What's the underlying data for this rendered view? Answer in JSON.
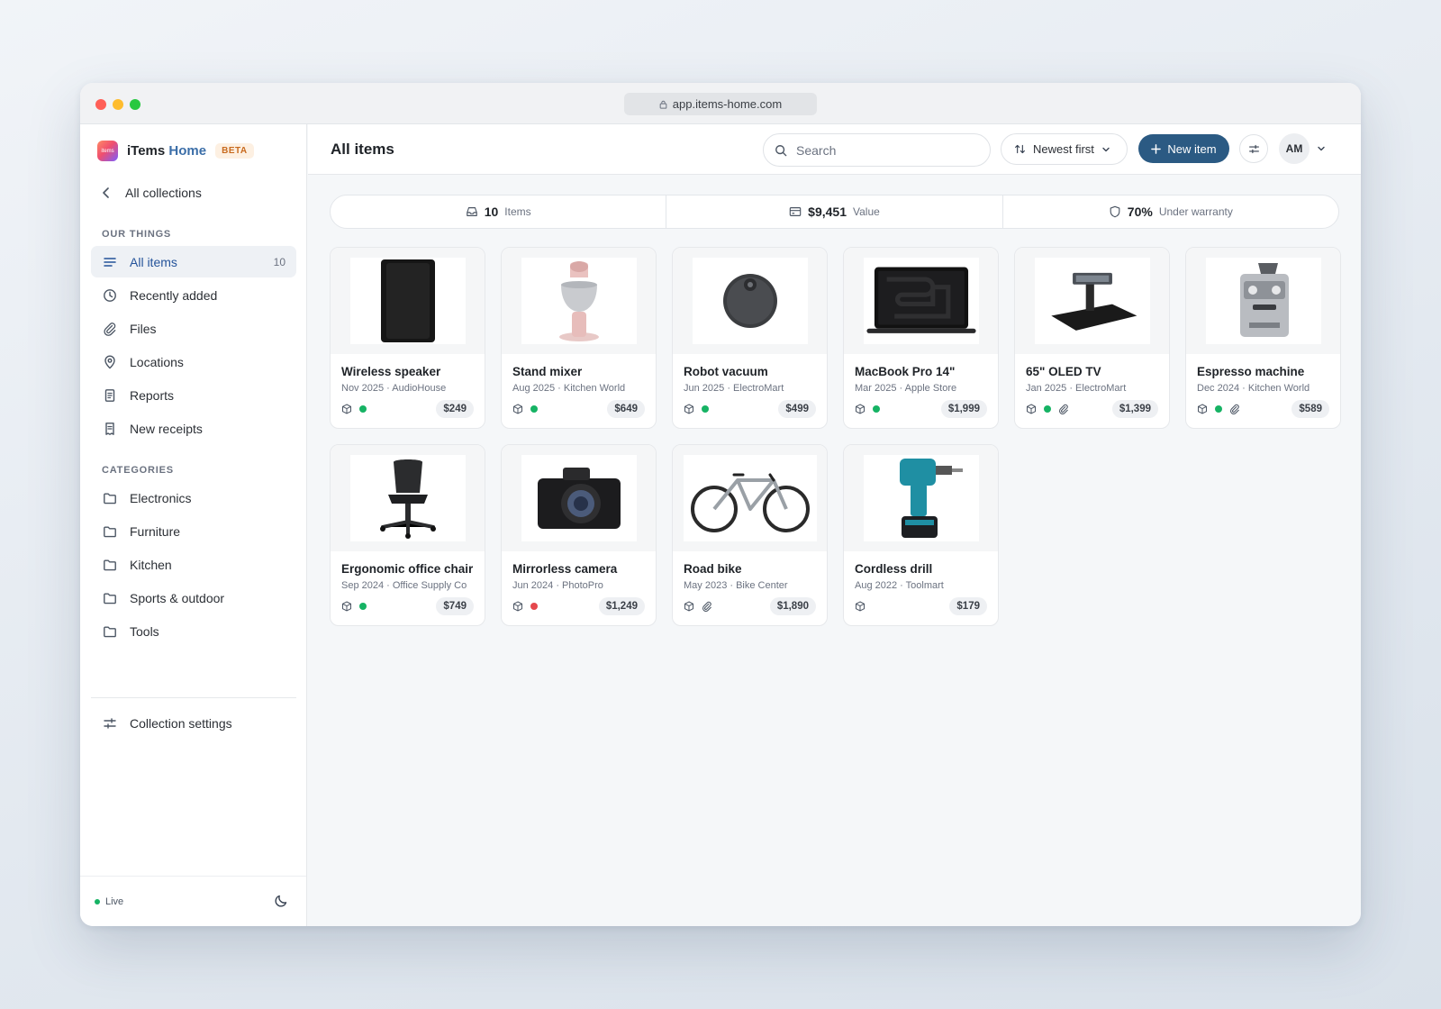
{
  "browser": {
    "url": "app.items-home.com"
  },
  "brand": {
    "logo_text": "items",
    "name": "iTems",
    "name_accent": "Home",
    "badge": "BETA"
  },
  "sidebar": {
    "back_label": "All collections",
    "section_things": "OUR THINGS",
    "items": [
      {
        "label": "All items",
        "count": "10",
        "icon": "list-icon"
      },
      {
        "label": "Recently added",
        "icon": "clock-icon"
      },
      {
        "label": "Files",
        "icon": "paperclip-icon"
      },
      {
        "label": "Locations",
        "icon": "pin-icon"
      },
      {
        "label": "Reports",
        "icon": "report-icon"
      },
      {
        "label": "New receipts",
        "icon": "receipt-icon"
      }
    ],
    "section_categories": "CATEGORIES",
    "categories": [
      "Electronics",
      "Furniture",
      "Kitchen",
      "Sports & outdoor",
      "Tools"
    ],
    "settings_label": "Collection settings",
    "status_label": "Live"
  },
  "header": {
    "title": "All items",
    "search_placeholder": "Search",
    "sort_label": "Newest first",
    "new_item_label": "New item",
    "avatar_initials": "AM"
  },
  "stats": {
    "items_num": "10",
    "items_label": "Items",
    "value_num": "$9,451",
    "value_label": "Value",
    "warranty_num": "70%",
    "warranty_label": "Under warranty"
  },
  "colors": {
    "accent": "#2b5a83",
    "status_ok": "#16b364",
    "status_alert": "#e5484d"
  },
  "cards": [
    {
      "name": "Wireless speaker",
      "meta": "Nov 2025 · AudioHouse",
      "price": "$249",
      "status": "ok",
      "attachment": false
    },
    {
      "name": "Stand mixer",
      "meta": "Aug 2025 · Kitchen World",
      "price": "$649",
      "status": "ok",
      "attachment": false
    },
    {
      "name": "Robot vacuum",
      "meta": "Jun 2025 · ElectroMart",
      "price": "$499",
      "status": "ok",
      "attachment": false
    },
    {
      "name": "MacBook Pro 14\"",
      "meta": "Mar 2025 · Apple Store",
      "price": "$1,999",
      "status": "ok",
      "attachment": false
    },
    {
      "name": "65\" OLED TV",
      "meta": "Jan 2025 · ElectroMart",
      "price": "$1,399",
      "status": "ok",
      "attachment": true
    },
    {
      "name": "Espresso machine",
      "meta": "Dec 2024 · Kitchen World",
      "price": "$589",
      "status": "ok",
      "attachment": true
    },
    {
      "name": "Ergonomic office chair",
      "meta": "Sep 2024 · Office Supply Co",
      "price": "$749",
      "status": "ok",
      "attachment": false
    },
    {
      "name": "Mirrorless camera",
      "meta": "Jun 2024 · PhotoPro",
      "price": "$1,249",
      "status": "alert",
      "attachment": false
    },
    {
      "name": "Road bike",
      "meta": "May 2023 · Bike Center",
      "price": "$1,890",
      "status": "none",
      "attachment": true
    },
    {
      "name": "Cordless drill",
      "meta": "Aug 2022 · Toolmart",
      "price": "$179",
      "status": "none",
      "attachment": false
    }
  ]
}
